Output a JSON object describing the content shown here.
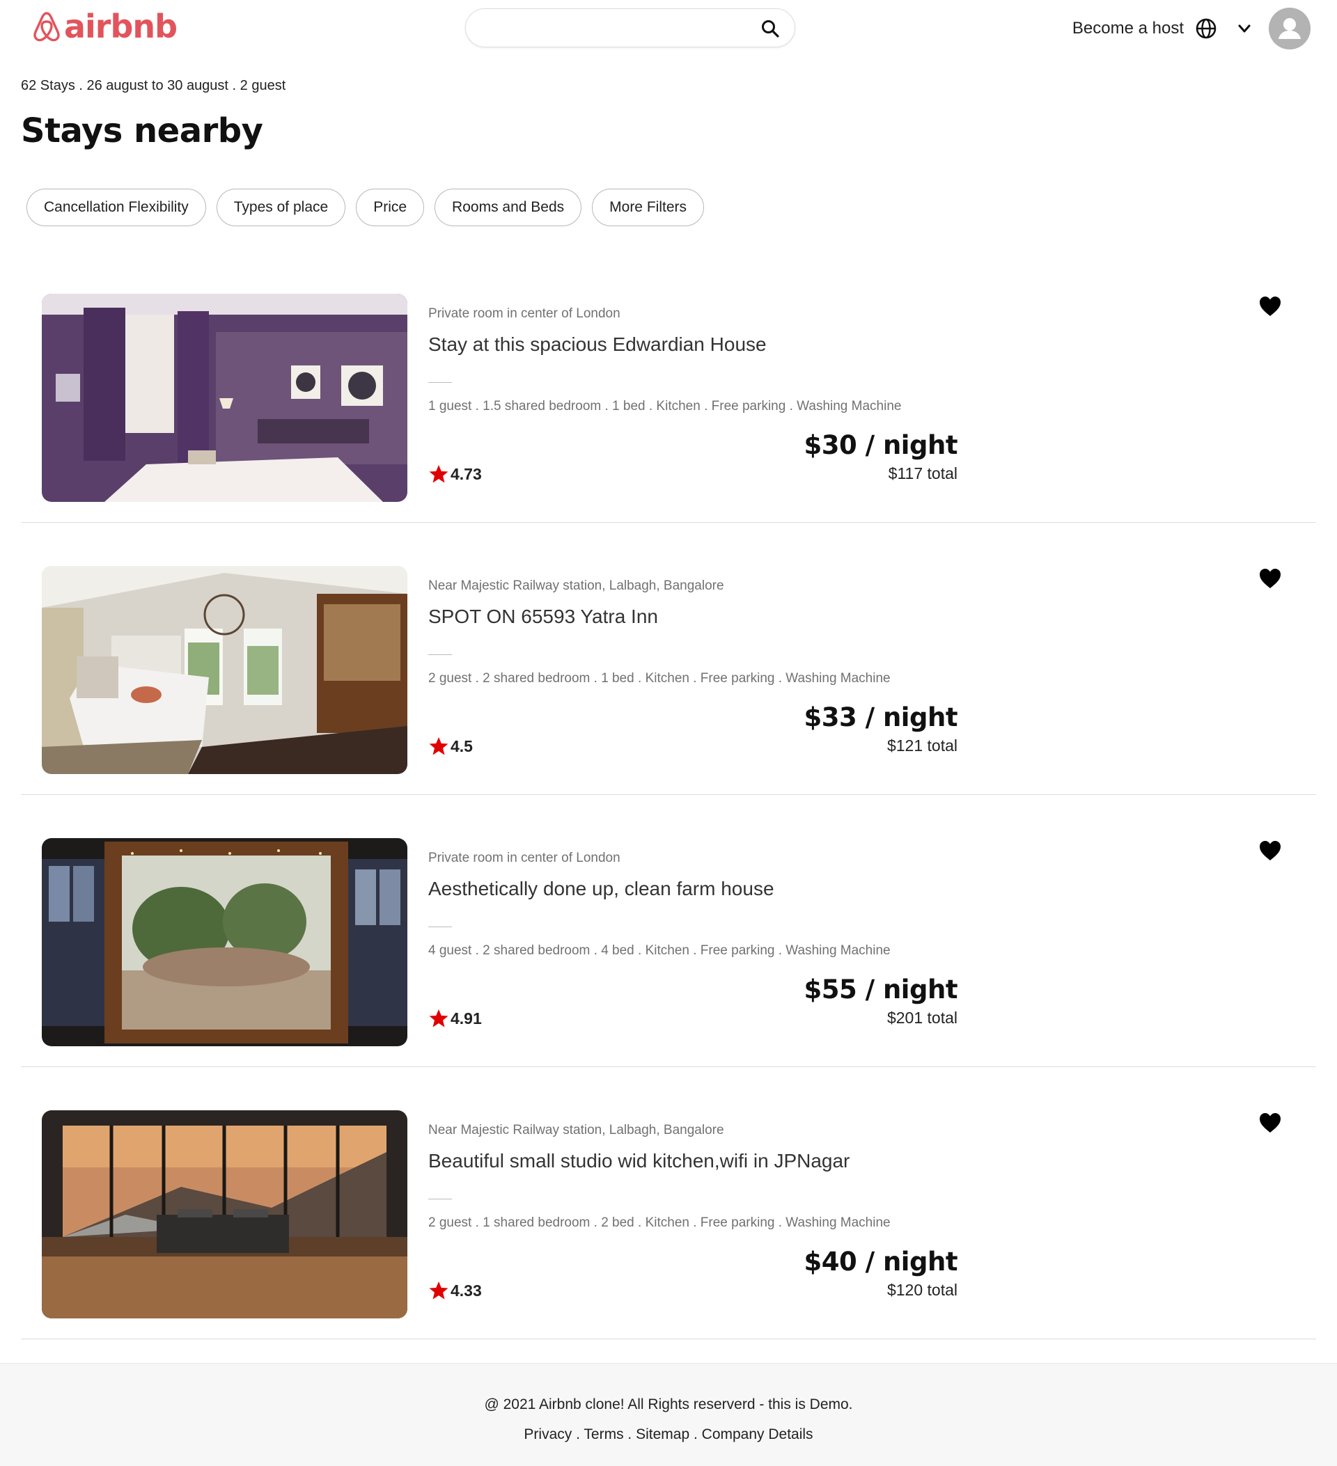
{
  "header": {
    "logo_text": "airbnb",
    "search": {
      "value": "",
      "placeholder": ""
    },
    "become_host": "Become a host"
  },
  "summary": "62 Stays . 26 august to 30 august . 2 guest",
  "page_title": "Stays nearby",
  "filters": [
    "Cancellation Flexibility",
    "Types of place",
    "Price",
    "Rooms and Beds",
    "More Filters"
  ],
  "listings": [
    {
      "location": "Private room in center of London",
      "title": "Stay at this spacious Edwardian House",
      "details": "1 guest . 1.5 shared bedroom . 1 bed . Kitchen . Free parking . Washing Machine",
      "rating": "4.73",
      "price": "$30 / night",
      "total": "$117 total"
    },
    {
      "location": "Near Majestic Railway station, Lalbagh, Bangalore",
      "title": "SPOT ON 65593 Yatra Inn",
      "details": "2 guest . 2 shared bedroom . 1 bed . Kitchen . Free parking . Washing Machine",
      "rating": "4.5",
      "price": "$33 / night",
      "total": "$121 total"
    },
    {
      "location": "Private room in center of London",
      "title": "Aesthetically done up, clean farm house",
      "details": "4 guest . 2 shared bedroom . 4 bed . Kitchen . Free parking . Washing Machine",
      "rating": "4.91",
      "price": "$55 / night",
      "total": "$201 total"
    },
    {
      "location": "Near Majestic Railway station, Lalbagh, Bangalore",
      "title": "Beautiful small studio wid kitchen,wifi in JPNagar",
      "details": "2 guest . 1 shared bedroom . 2 bed . Kitchen . Free parking . Washing Machine",
      "rating": "4.33",
      "price": "$40 / night",
      "total": "$120 total"
    }
  ],
  "footer": {
    "copyright": "@ 2021 Airbnb clone! All Rights reserverd - this is Demo.",
    "links": [
      "Privacy",
      "Terms",
      "Sitemap",
      "Company Details"
    ],
    "separator": " . "
  },
  "colors": {
    "brand": "#e2545c",
    "star": "#e00000",
    "muted": "#717171"
  },
  "icons": [
    "airbnb-logo-icon",
    "search-icon",
    "globe-icon",
    "chevron-down-icon",
    "user-avatar-icon",
    "star-icon",
    "heart-icon"
  ]
}
